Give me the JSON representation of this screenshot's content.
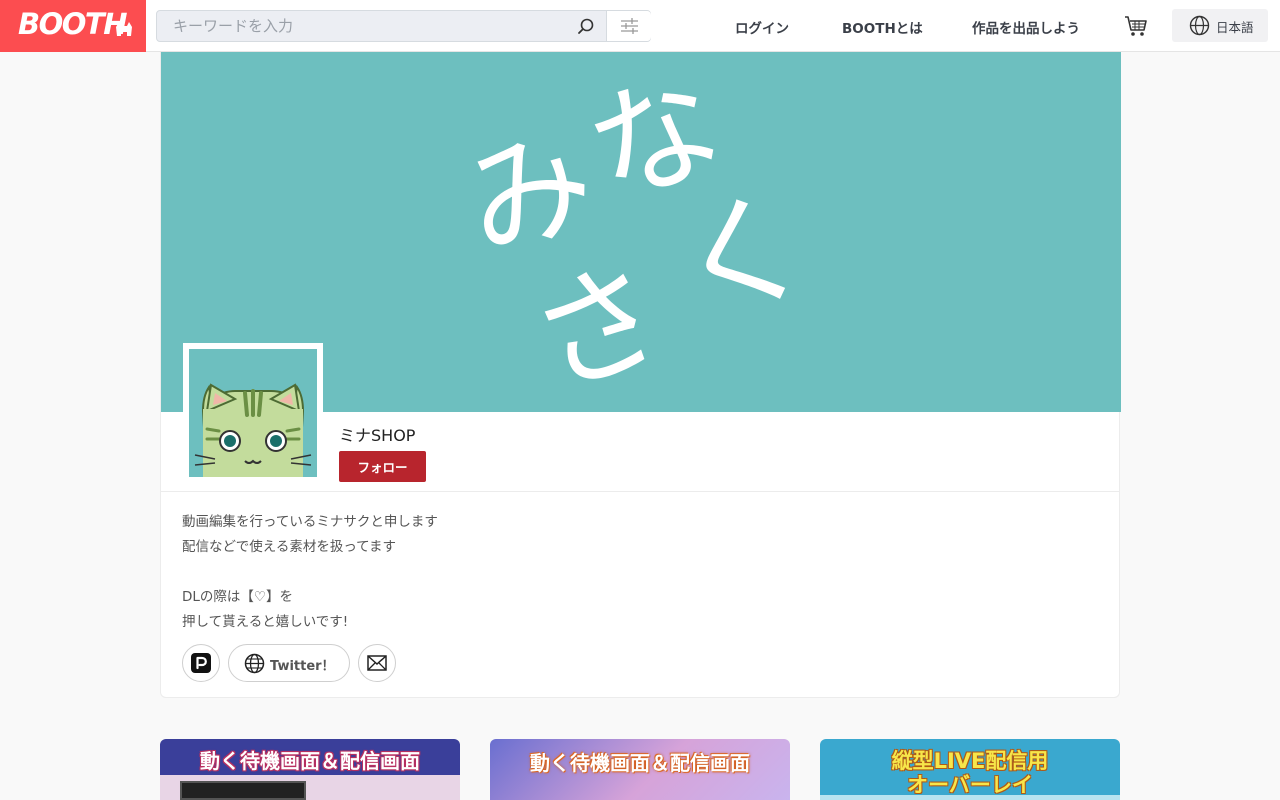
{
  "header": {
    "logo_text": "BOOTH",
    "search_placeholder": "キーワードを入力",
    "nav": {
      "login": "ログイン",
      "about": "BOOTHとは",
      "sell": "作品を出品しよう"
    },
    "language": "日本語"
  },
  "shop": {
    "banner_text": [
      "み",
      "な",
      "さ",
      "く"
    ],
    "name": "ミナSHOP",
    "follow_label": "フォロー",
    "description": [
      "動画編集を行っているミナサクと申します",
      "配信などで使える素材を扱ってます",
      "",
      "DLの際は【♡】を",
      "押して貰えると嬉しいです!"
    ],
    "links": {
      "twitter_label": "Twitter！"
    }
  },
  "items": [
    {
      "thumb_text": "動く待機画面＆配信画面"
    },
    {
      "thumb_text": "動く待機画面＆配信画面"
    },
    {
      "thumb_text_1": "縦型LIVE配信用",
      "thumb_text_2": "オーバーレイ"
    }
  ],
  "colors": {
    "brand": "#fc4d50",
    "banner": "#6dbfbf",
    "follow": "#b8252d"
  },
  "icons": [
    "search-icon",
    "filter-icon",
    "cart-icon",
    "globe-icon",
    "pixiv-icon",
    "mail-icon"
  ]
}
